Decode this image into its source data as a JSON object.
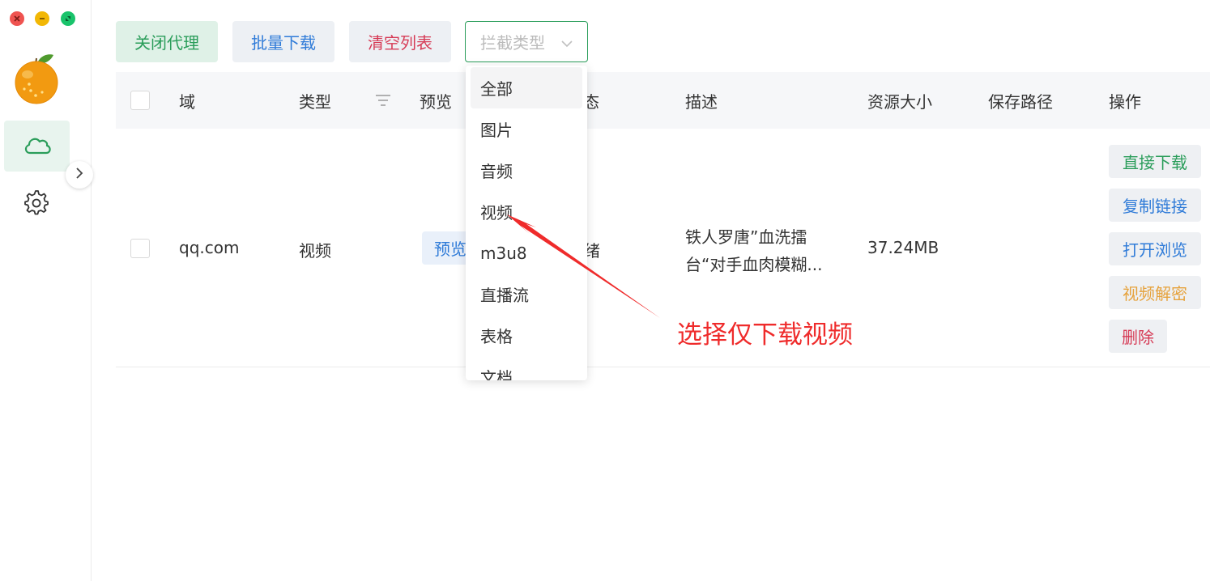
{
  "toolbar": {
    "proxy_label": "关闭代理",
    "batch_label": "批量下载",
    "clear_label": "清空列表",
    "filter_placeholder": "拦截类型"
  },
  "table": {
    "headers": {
      "domain": "域",
      "type": "类型",
      "preview": "预览",
      "status": "态",
      "desc": "描述",
      "size": "资源大小",
      "path": "保存路径",
      "ops": "操作"
    },
    "rows": [
      {
        "domain": "qq.com",
        "type": "视频",
        "preview": "预览",
        "status": "绪",
        "desc": "铁人罗唐”血洗擂台“对手血肉模糊...",
        "size": "37.24MB",
        "path": "",
        "ops": [
          "直接下载",
          "复制链接",
          "打开浏览",
          "视频解密",
          "删除"
        ]
      }
    ]
  },
  "dropdown": {
    "options": [
      "全部",
      "图片",
      "音频",
      "视频",
      "m3u8",
      "直播流",
      "表格",
      "文档"
    ],
    "highlighted": "全部"
  },
  "annotation": "选择仅下载视频",
  "colors": {
    "accent": "#2a9d5a",
    "link": "#2f7bd8",
    "danger": "#d63a55",
    "warning": "#e6a23c",
    "annotation": "#ef2b2b"
  },
  "icons": [
    "close-icon",
    "minimize-icon",
    "maximize-icon",
    "orange-logo",
    "cloud-icon",
    "chevron-right-icon",
    "gear-icon",
    "chevron-down-icon",
    "filter-icon"
  ]
}
